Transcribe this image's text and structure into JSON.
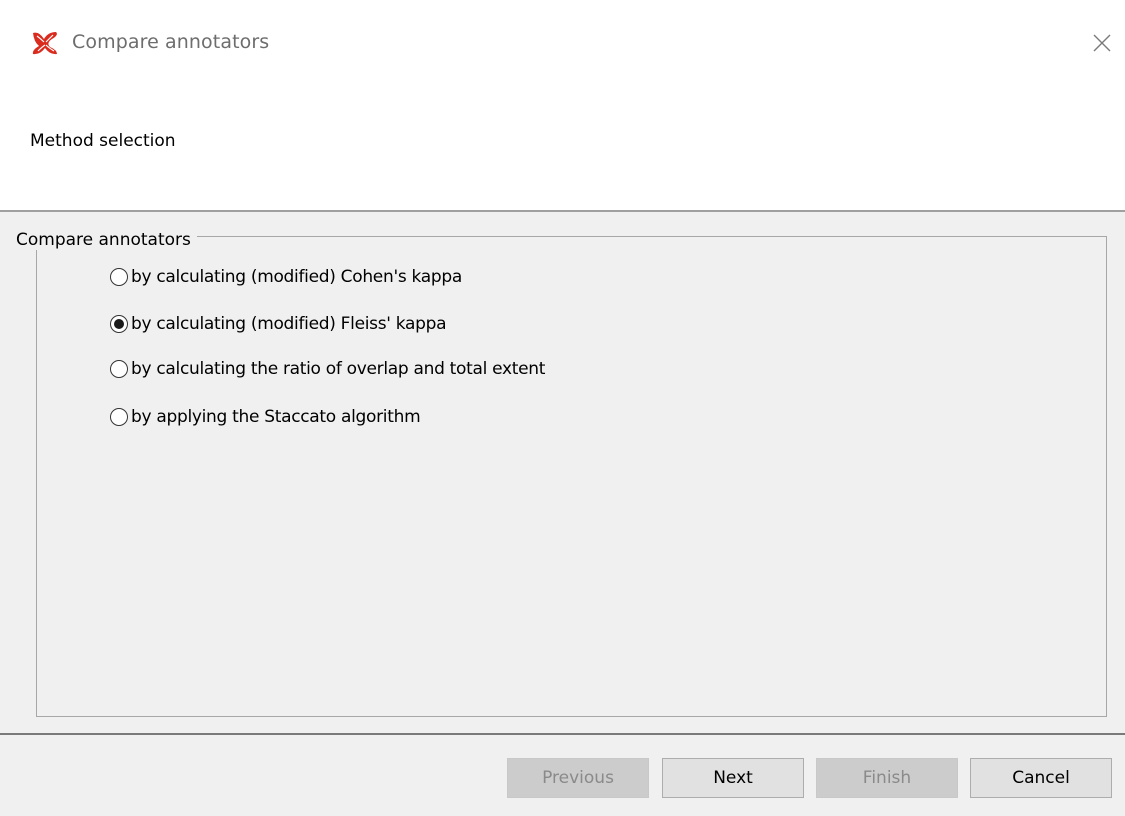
{
  "window": {
    "title": "Compare annotators",
    "app_icon": "red-app-logo-icon",
    "close_icon": "close-icon"
  },
  "header": {
    "title": "Method selection"
  },
  "group": {
    "title": "Compare annotators",
    "options": [
      {
        "label": "by calculating (modified) Cohen's kappa",
        "selected": false
      },
      {
        "label": "by calculating (modified) Fleiss' kappa",
        "selected": true
      },
      {
        "label": "by calculating the ratio of overlap and total extent",
        "selected": false
      },
      {
        "label": "by applying the Staccato algorithm",
        "selected": false
      }
    ]
  },
  "footer": {
    "previous_label": "Previous",
    "next_label": "Next",
    "finish_label": "Finish",
    "cancel_label": "Cancel",
    "previous_enabled": false,
    "next_enabled": true,
    "finish_enabled": false,
    "cancel_enabled": true
  },
  "colors": {
    "accent": "#d92b1e",
    "content_bg": "#f0f0f0",
    "title_text": "#6d6d6d"
  }
}
